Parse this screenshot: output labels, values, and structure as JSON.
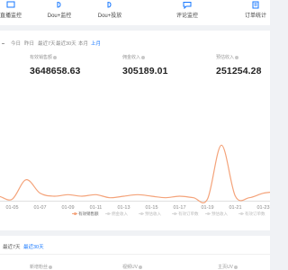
{
  "nav": [
    {
      "label": "直播监控",
      "icon": "live-monitor-icon"
    },
    {
      "label": "Dou+监控",
      "icon": "dou-monitor-icon"
    },
    {
      "label": "Dou+投放",
      "icon": "dou-delivery-icon"
    },
    {
      "label": "评论监控",
      "icon": "comment-monitor-icon"
    },
    {
      "label": "订单统计",
      "icon": "order-stats-icon"
    }
  ],
  "timebar": {
    "options": [
      "今日",
      "昨日",
      "最近7天",
      "最近30天",
      "本月",
      "上月"
    ],
    "active_index": 5
  },
  "metrics": [
    {
      "label": "有效销售额",
      "value": "3648658.63"
    },
    {
      "label": "佣金收入",
      "value": "305189.01"
    },
    {
      "label": "预估收入",
      "value": "251254.28"
    }
  ],
  "chart_data": {
    "type": "line",
    "x_tick_labels": [
      "01-05",
      "01-07",
      "01-09",
      "01-11",
      "01-13",
      "01-15",
      "01-17",
      "01-19",
      "01-21",
      "01-23"
    ],
    "x": [
      "01-03",
      "01-04",
      "01-05",
      "01-06",
      "01-07",
      "01-08",
      "01-09",
      "01-10",
      "01-11",
      "01-12",
      "01-13",
      "01-14",
      "01-15",
      "01-16",
      "01-17",
      "01-18",
      "01-19",
      "01-20",
      "01-21",
      "01-22",
      "01-23",
      "01-24"
    ],
    "series": [
      {
        "name": "有效销售额",
        "color": "#f4a37a",
        "values": [
          2,
          3,
          1,
          14,
          5,
          3,
          4,
          3,
          4,
          2,
          3,
          4,
          3,
          2,
          3,
          2,
          1,
          37,
          3,
          2,
          5,
          6
        ]
      }
    ],
    "ylim": [
      0,
      75
    ],
    "grid": false,
    "legend_position": "bottom",
    "legend": [
      {
        "name": "有效销售额",
        "color": "#f4a37a",
        "active": true
      },
      {
        "name": "佣金收入",
        "color": "#d9d9d9",
        "active": false
      },
      {
        "name": "预估收入",
        "color": "#d9d9d9",
        "active": false
      },
      {
        "name": "有效订单数",
        "color": "#d9d9d9",
        "active": false
      },
      {
        "name": "预估收入",
        "color": "#d9d9d9",
        "active": false
      },
      {
        "name": "有效订单数",
        "color": "#d9d9d9",
        "active": false
      }
    ]
  },
  "panel2": {
    "tabs": [
      "最近7天",
      "最近30天"
    ],
    "active_tab": 1,
    "columns": [
      "新增粉丝",
      "视频UV",
      "主页UV"
    ]
  },
  "colors": {
    "accent": "#1677ff",
    "line": "#f4a37a"
  }
}
